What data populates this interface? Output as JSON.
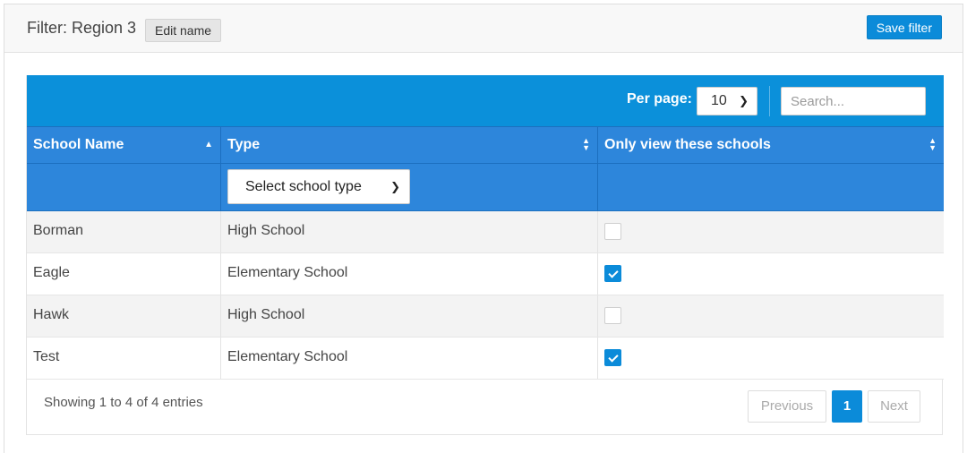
{
  "header": {
    "filter_title": "Filter: Region 3",
    "edit_name_label": "Edit name",
    "save_filter_label": "Save filter"
  },
  "toolbar": {
    "per_page_label": "Per page:",
    "per_page_value": "10",
    "search_placeholder": "Search..."
  },
  "table": {
    "columns": [
      {
        "label": "School Name",
        "sort": "asc"
      },
      {
        "label": "Type",
        "sort": "none"
      },
      {
        "label": "Only view these schools",
        "sort": "none"
      }
    ],
    "type_filter_label": "Select school type",
    "rows": [
      {
        "name": "Borman",
        "type": "High School",
        "checked": false
      },
      {
        "name": "Eagle",
        "type": "Elementary School",
        "checked": true
      },
      {
        "name": "Hawk",
        "type": "High School",
        "checked": false
      },
      {
        "name": "Test",
        "type": "Elementary School",
        "checked": true
      }
    ]
  },
  "footer": {
    "info": "Showing 1 to 4 of 4 entries",
    "previous_label": "Previous",
    "current_page": "1",
    "next_label": "Next"
  },
  "colors": {
    "toolbar_blue": "#0b90da",
    "header_blue": "#2d86db",
    "accent": "#0b8bd9"
  }
}
